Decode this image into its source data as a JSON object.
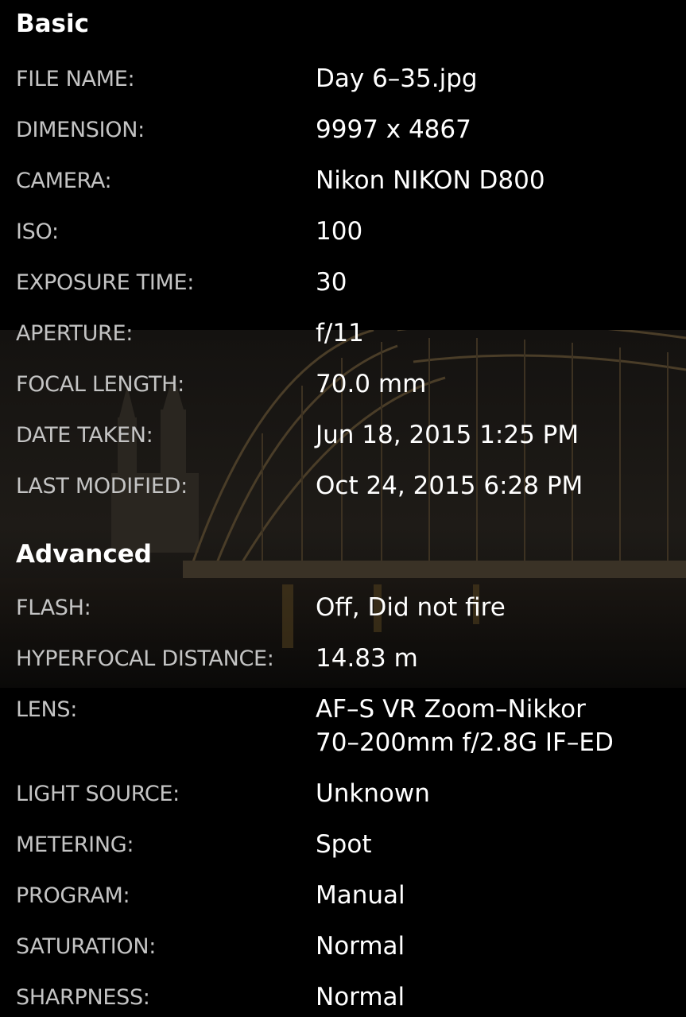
{
  "sections": {
    "basic": {
      "title": "Basic",
      "rows": [
        {
          "label": "FILE NAME:",
          "value": "Day 6–35.jpg"
        },
        {
          "label": "DIMENSION:",
          "value": "9997 x 4867"
        },
        {
          "label": "CAMERA:",
          "value": "Nikon NIKON D800"
        },
        {
          "label": "ISO:",
          "value": "100"
        },
        {
          "label": "EXPOSURE TIME:",
          "value": "30"
        },
        {
          "label": "APERTURE:",
          "value": "f/11"
        },
        {
          "label": "FOCAL LENGTH:",
          "value": "70.0 mm"
        },
        {
          "label": "DATE TAKEN:",
          "value": "Jun 18, 2015 1:25 PM"
        },
        {
          "label": "LAST MODIFIED:",
          "value": "Oct 24, 2015 6:28 PM"
        }
      ]
    },
    "advanced": {
      "title": "Advanced",
      "rows": [
        {
          "label": "FLASH:",
          "value": "Off, Did not fire"
        },
        {
          "label": "HYPERFOCAL DISTANCE:",
          "value": "14.83 m"
        },
        {
          "label": "LENS:",
          "value": "AF–S VR Zoom–Nikkor",
          "value2": "70–200mm f/2.8G IF–ED"
        },
        {
          "label": "LIGHT SOURCE:",
          "value": "Unknown"
        },
        {
          "label": "METERING:",
          "value": "Spot"
        },
        {
          "label": "PROGRAM:",
          "value": "Manual"
        },
        {
          "label": "SATURATION:",
          "value": "Normal"
        },
        {
          "label": "SHARPNESS:",
          "value": "Normal"
        }
      ]
    }
  },
  "colors": {
    "background": "#000000",
    "label": "#c4c4c4",
    "value": "#ffffff",
    "heading": "#ffffff"
  }
}
